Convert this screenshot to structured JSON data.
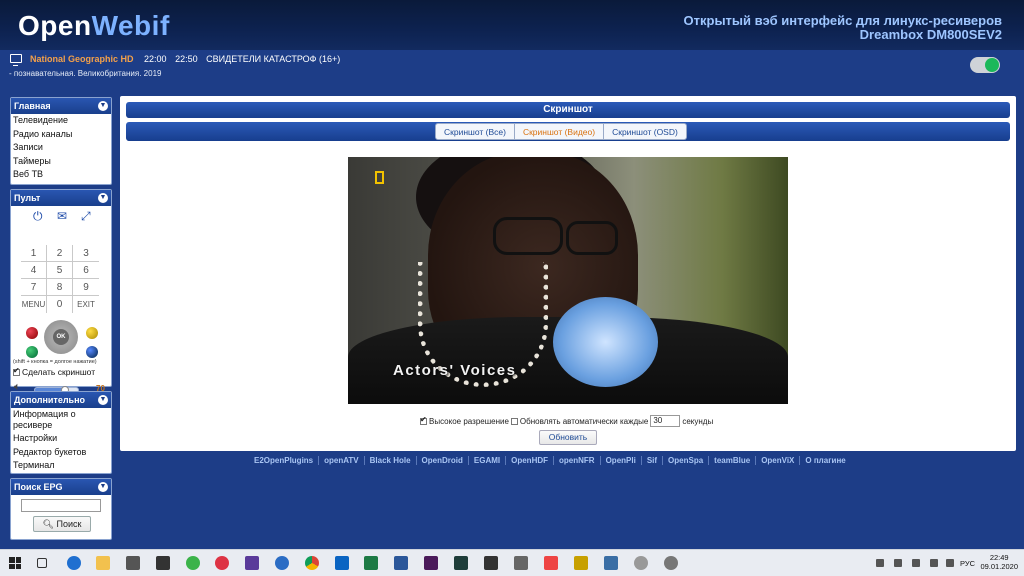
{
  "header": {
    "logo_open": "Open",
    "logo_webif": "Webif",
    "title": "Открытый вэб интерфейс для линукс-ресиверов",
    "subtitle": "Dreambox DM800SEV2"
  },
  "now_playing": {
    "channel": "National Geographic HD",
    "start": "22:00",
    "end": "22:50",
    "program": "СВИДЕТЕЛИ КАТАСТРОФ (16+)",
    "description": "- познавательная. Великобритания. 2019"
  },
  "sidebar": {
    "main": {
      "title": "Главная",
      "items": [
        "Телевидение",
        "Радио каналы",
        "Записи",
        "Таймеры",
        "Веб ТВ"
      ]
    },
    "remote": {
      "title": "Пульт",
      "keys": [
        [
          "1",
          "2",
          "3"
        ],
        [
          "4",
          "5",
          "6"
        ],
        [
          "7",
          "8",
          "9"
        ],
        [
          "MENU",
          "0",
          "EXIT"
        ]
      ],
      "ok_label": "OK",
      "shift_note": "(shift + кнопка = долгое нажатие)",
      "screenshot_label": "Сделать скриншот",
      "volume": 70,
      "volume_label": "70"
    },
    "extra": {
      "title": "Дополнительно",
      "items": [
        "Информация о ресивере",
        "Настройки",
        "Редактор букетов",
        "Терминал"
      ]
    },
    "epg": {
      "title": "Поиск EPG",
      "search_value": "",
      "search_button": "Поиск"
    }
  },
  "main": {
    "title": "Скриншот",
    "tabs": [
      {
        "label": "Скриншот (Все)",
        "active": false
      },
      {
        "label": "Скриншот (Видео)",
        "active": true
      },
      {
        "label": "Скриншот (OSD)",
        "active": false
      }
    ],
    "screenshot_caption": "Actors' Voices",
    "opt_hires": "Высокое разрешение",
    "opt_auto": "Обновлять автоматически каждые",
    "seconds_value": "30",
    "seconds_label": "секунды",
    "refresh_button": "Обновить"
  },
  "footer_links": [
    "E2OpenPlugins",
    "openATV",
    "Black Hole",
    "OpenDroid",
    "EGAMI",
    "OpenHDF",
    "openNFR",
    "OpenPli",
    "Sif",
    "OpenSpa",
    "teamBlue",
    "OpenViX",
    "О плагине"
  ],
  "taskbar": {
    "language": "РУС",
    "time": "22:49",
    "date": "09.01.2020"
  },
  "colors": {
    "background": "#1d3d87",
    "accent": "#d9720f",
    "channel": "#f3a04a"
  }
}
